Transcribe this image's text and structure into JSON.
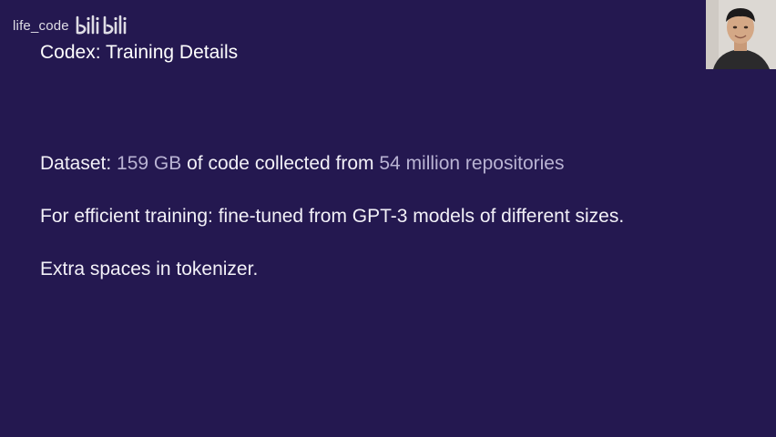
{
  "watermark": {
    "username": "life_code",
    "logo_icon": "bilibili-logo-icon"
  },
  "slide": {
    "title": "Codex: Training Details",
    "bullets": [
      {
        "segments": [
          {
            "text": "Dataset: ",
            "highlight": false
          },
          {
            "text": "159 GB",
            "highlight": true
          },
          {
            "text": " of code collected from ",
            "highlight": false
          },
          {
            "text": "54 million repositories",
            "highlight": true
          }
        ]
      },
      {
        "segments": [
          {
            "text": "For efficient training: fine-tuned from GPT-3 models of different sizes.",
            "highlight": false
          }
        ]
      },
      {
        "segments": [
          {
            "text": "Extra spaces in tokenizer.",
            "highlight": false
          }
        ]
      }
    ]
  },
  "speaker": {
    "icon": "presenter-webcam-thumbnail"
  },
  "colors": {
    "background": "#241850",
    "text": "#f2f0f7",
    "highlight": "#b9b3d3"
  }
}
